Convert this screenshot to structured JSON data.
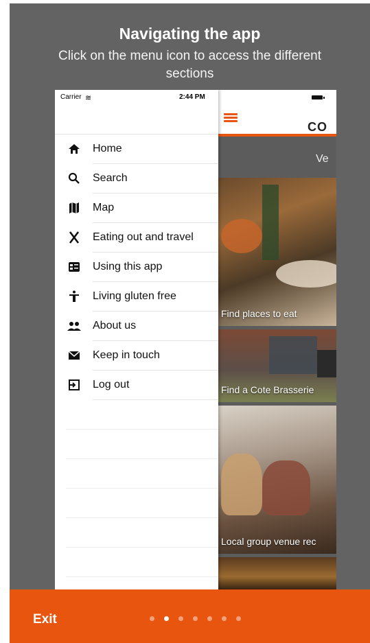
{
  "tutorial": {
    "heading": "Navigating the app",
    "subtext": "Click on the menu icon to access the different sections"
  },
  "status_bar": {
    "carrier": "Carrier",
    "time": "2:44 PM"
  },
  "menu": {
    "items": [
      {
        "label": "Home",
        "icon": "home-icon",
        "glyph": "⌂"
      },
      {
        "label": "Search",
        "icon": "search-icon",
        "glyph": "🔍"
      },
      {
        "label": "Map",
        "icon": "map-icon",
        "glyph": "🗺"
      },
      {
        "label": "Eating out and travel",
        "icon": "cutlery-icon",
        "glyph": "✕"
      },
      {
        "label": "Using this app",
        "icon": "phone-info-icon",
        "glyph": "▣"
      },
      {
        "label": "Living gluten free",
        "icon": "person-icon",
        "glyph": "✝"
      },
      {
        "label": "About us",
        "icon": "people-icon",
        "glyph": "👥"
      },
      {
        "label": "Keep in touch",
        "icon": "envelope-icon",
        "glyph": "✉"
      },
      {
        "label": "Log out",
        "icon": "logout-icon",
        "glyph": "⇥"
      }
    ]
  },
  "app": {
    "brand": "CO",
    "venue_label": "Ve",
    "cards": [
      {
        "caption": "Find places to eat"
      },
      {
        "caption": "Find a Cote Brasserie"
      },
      {
        "caption": "Local group venue rec"
      },
      {
        "caption": ""
      }
    ]
  },
  "footer": {
    "exit_label": "Exit",
    "page_count": 7,
    "current_page": 2
  },
  "colors": {
    "accent": "#e8550f",
    "overlay": "#636363"
  }
}
